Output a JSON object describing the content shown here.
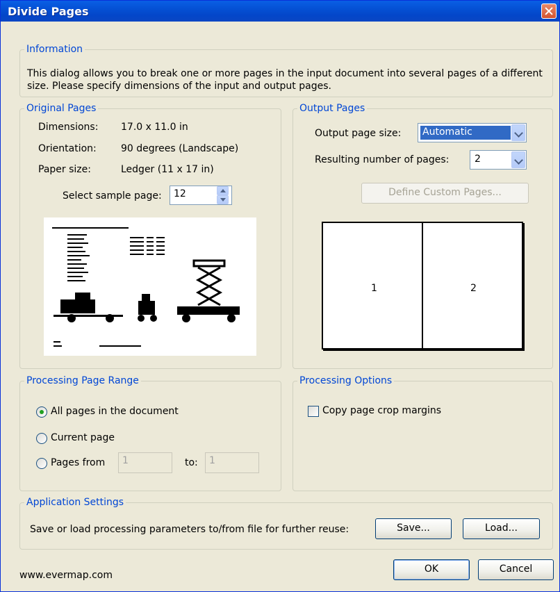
{
  "window": {
    "title": "Divide Pages"
  },
  "information": {
    "legend": "Information",
    "text": "This dialog allows you to break one or more pages in the input document into several pages of a different size. Please specify dimensions of the input and output pages."
  },
  "original": {
    "legend": "Original Pages",
    "dimensions_label": "Dimensions:",
    "dimensions_value": "17.0 x 11.0 in",
    "orientation_label": "Orientation:",
    "orientation_value": "90 degrees (Landscape)",
    "paper_label": "Paper size:",
    "paper_value": "Ledger (11 x 17 in)",
    "sample_label": "Select sample page:",
    "sample_value": "12"
  },
  "output": {
    "legend": "Output Pages",
    "size_label": "Output page size:",
    "size_value": "Automatic",
    "count_label": "Resulting number of pages:",
    "count_value": "2",
    "custom_button": "Define Custom Pages...",
    "page_labels": [
      "1",
      "2"
    ]
  },
  "range": {
    "legend": "Processing Page Range",
    "all": "All pages in the document",
    "current": "Current page",
    "from": "Pages from",
    "from_value": "1",
    "to": "to:",
    "to_value": "1"
  },
  "options": {
    "legend": "Processing Options",
    "copy_margins": "Copy page crop margins"
  },
  "app": {
    "legend": "Application Settings",
    "text": "Save or load processing parameters to/from file for further reuse:",
    "save": "Save...",
    "load": "Load..."
  },
  "footer": {
    "website": "www.evermap.com",
    "ok": "OK",
    "cancel": "Cancel"
  }
}
